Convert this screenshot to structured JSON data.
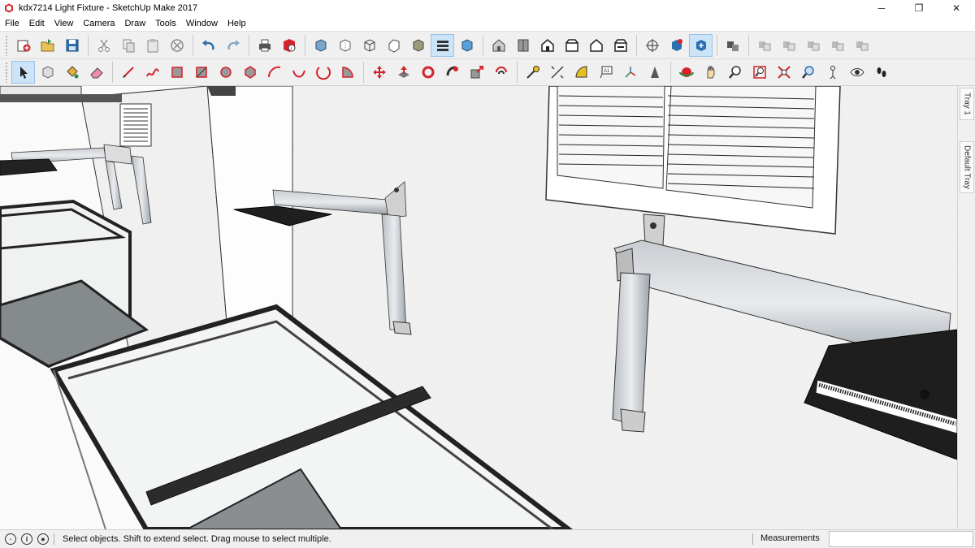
{
  "window": {
    "title": "kdx7214 Light Fixture - SketchUp Make 2017",
    "minimize_glyph": "─",
    "maximize_glyph": "❐",
    "close_glyph": "✕"
  },
  "menu": [
    "File",
    "Edit",
    "View",
    "Camera",
    "Draw",
    "Tools",
    "Window",
    "Help"
  ],
  "toolbar_top": [
    "new-model-icon",
    "open-icon",
    "save-icon",
    "cut-icon",
    "copy-icon",
    "paste-icon",
    "erase-icon",
    "undo-icon",
    "redo-icon",
    "print-icon",
    "model-info-icon",
    "xray-icon",
    "back-edges-icon",
    "wireframe-icon",
    "hidden-line-icon",
    "shaded-icon",
    "shaded-textures-icon",
    "monochrome-icon",
    "iso-view-icon",
    "top-view-icon",
    "front-view-icon",
    "right-view-icon",
    "back-view-icon",
    "left-view-icon",
    "position-camera-icon",
    "get-models-icon",
    "share-model-icon",
    "3d-warehouse-icon",
    "components-icon",
    "add-location-icon",
    "toggle-terrain-icon",
    "photo-textures-icon",
    "preview-icon"
  ],
  "toolbar_bottom": [
    "select-icon",
    "component-icon",
    "paint-bucket-icon",
    "eraser-icon",
    "line-icon",
    "freehand-icon",
    "rectangle-icon",
    "rotated-rectangle-icon",
    "circle-icon",
    "polygon-icon",
    "arc-icon",
    "2pt-arc-icon",
    "3pt-arc-icon",
    "pie-icon",
    "move-icon",
    "push-pull-icon",
    "rotate-icon",
    "follow-me-icon",
    "scale-icon",
    "offset-icon",
    "tape-measure-icon",
    "dimension-icon",
    "protractor-icon",
    "text-icon",
    "axes-icon",
    "3d-text-icon",
    "orbit-icon",
    "pan-icon",
    "zoom-icon",
    "zoom-window-icon",
    "zoom-extents-icon",
    "previous-view-icon",
    "position-camera-2-icon",
    "look-around-icon",
    "walk-icon"
  ],
  "tray": {
    "tab1": "Tray 1",
    "tab2": "Default Tray"
  },
  "status": {
    "message": "Select objects. Shift to extend select. Drag mouse to select multiple.",
    "measurements_label": "Measurements",
    "measurements_value": ""
  },
  "colors": {
    "accent": "#cce4f7",
    "toolbar_bg": "#f0f0f0",
    "red_icon": "#d4232b",
    "blue_icon": "#2a6fb0"
  }
}
